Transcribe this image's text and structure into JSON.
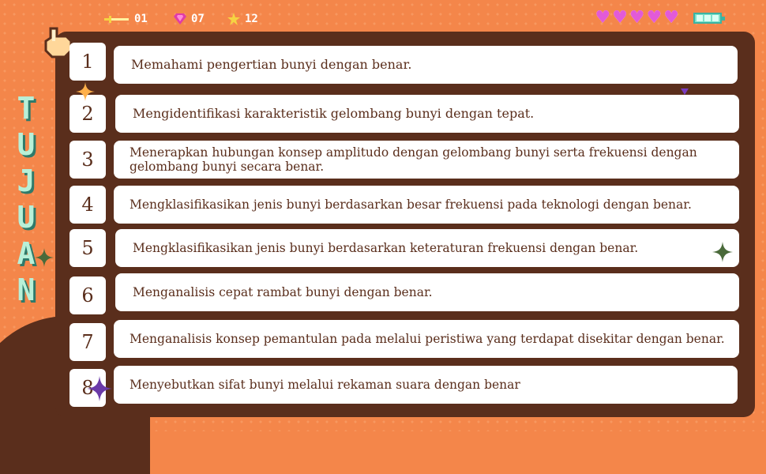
{
  "hud": {
    "sword_count": "01",
    "gem_count": "07",
    "star_count": "12",
    "hearts": 5,
    "battery_cells": 3
  },
  "side_title": [
    "T",
    "U",
    "J",
    "U",
    "A",
    "N"
  ],
  "items": [
    {
      "number": "1",
      "text": "Memahami pengertian bunyi dengan benar."
    },
    {
      "number": "2",
      "text": "Mengidentifikasi karakteristik gelombang bunyi dengan tepat."
    },
    {
      "number": "3",
      "text": "Menerapkan hubungan konsep amplitudo dengan gelombang bunyi serta frekuensi dengan gelombang bunyi secara benar."
    },
    {
      "number": "4",
      "text": "Mengklasifikasikan jenis bunyi berdasarkan besar frekuensi pada teknologi dengan benar."
    },
    {
      "number": "5",
      "text": "Mengklasifikasikan jenis bunyi berdasarkan keteraturan frekuensi dengan benar."
    },
    {
      "number": "6",
      "text": "Menganalisis cepat rambat bunyi dengan benar."
    },
    {
      "number": "7",
      "text": "Menganalisis konsep pemantulan pada melalui peristiwa yang terdapat disekitar dengan benar."
    },
    {
      "number": "8",
      "text": "Menyebutkan sifat bunyi melalui rekaman suara dengan benar"
    }
  ],
  "colors": {
    "background": "#f4864a",
    "panel": "#5a2e1c",
    "accent_text": "#b8f0d8",
    "heart": "#e25ad8"
  }
}
